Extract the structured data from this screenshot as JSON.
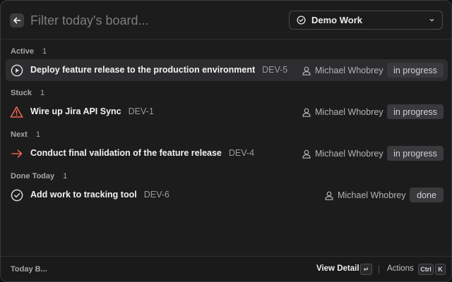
{
  "header": {
    "search_placeholder": "Filter today's board...",
    "board_select": {
      "selected": "Demo Work"
    }
  },
  "sections": [
    {
      "label": "Active",
      "count": "1"
    },
    {
      "label": "Stuck",
      "count": "1"
    },
    {
      "label": "Next",
      "count": "1"
    },
    {
      "label": "Done Today",
      "count": "1"
    }
  ],
  "items": [
    {
      "title": "Deploy feature release to the production environment",
      "id": "DEV-5",
      "assignee": "Michael Whobrey",
      "status": "in progress",
      "icon": "play-circle-icon"
    },
    {
      "title": "Wire up Jira API Sync",
      "id": "DEV-1",
      "assignee": "Michael Whobrey",
      "status": "in progress",
      "icon": "warning-triangle-icon"
    },
    {
      "title": "Conduct final validation of the feature release",
      "id": "DEV-4",
      "assignee": "Michael Whobrey",
      "status": "in progress",
      "icon": "arrow-right-icon"
    },
    {
      "title": "Add work to tracking tool",
      "id": "DEV-6",
      "assignee": "Michael Whobrey",
      "status": "done",
      "icon": "check-circle-icon"
    }
  ],
  "footer": {
    "left_label": "Today B...",
    "view_detail_label": "View Detail",
    "enter_key": "↵",
    "actions_label": "Actions",
    "ctrl_key": "Ctrl",
    "k_key": "K"
  },
  "colors": {
    "background": "#1c1c1d",
    "selected_row": "#2d2d2f",
    "badge": "#3a3a3d",
    "stuck_icon": "#e8654f",
    "next_icon": "#e8654f"
  }
}
